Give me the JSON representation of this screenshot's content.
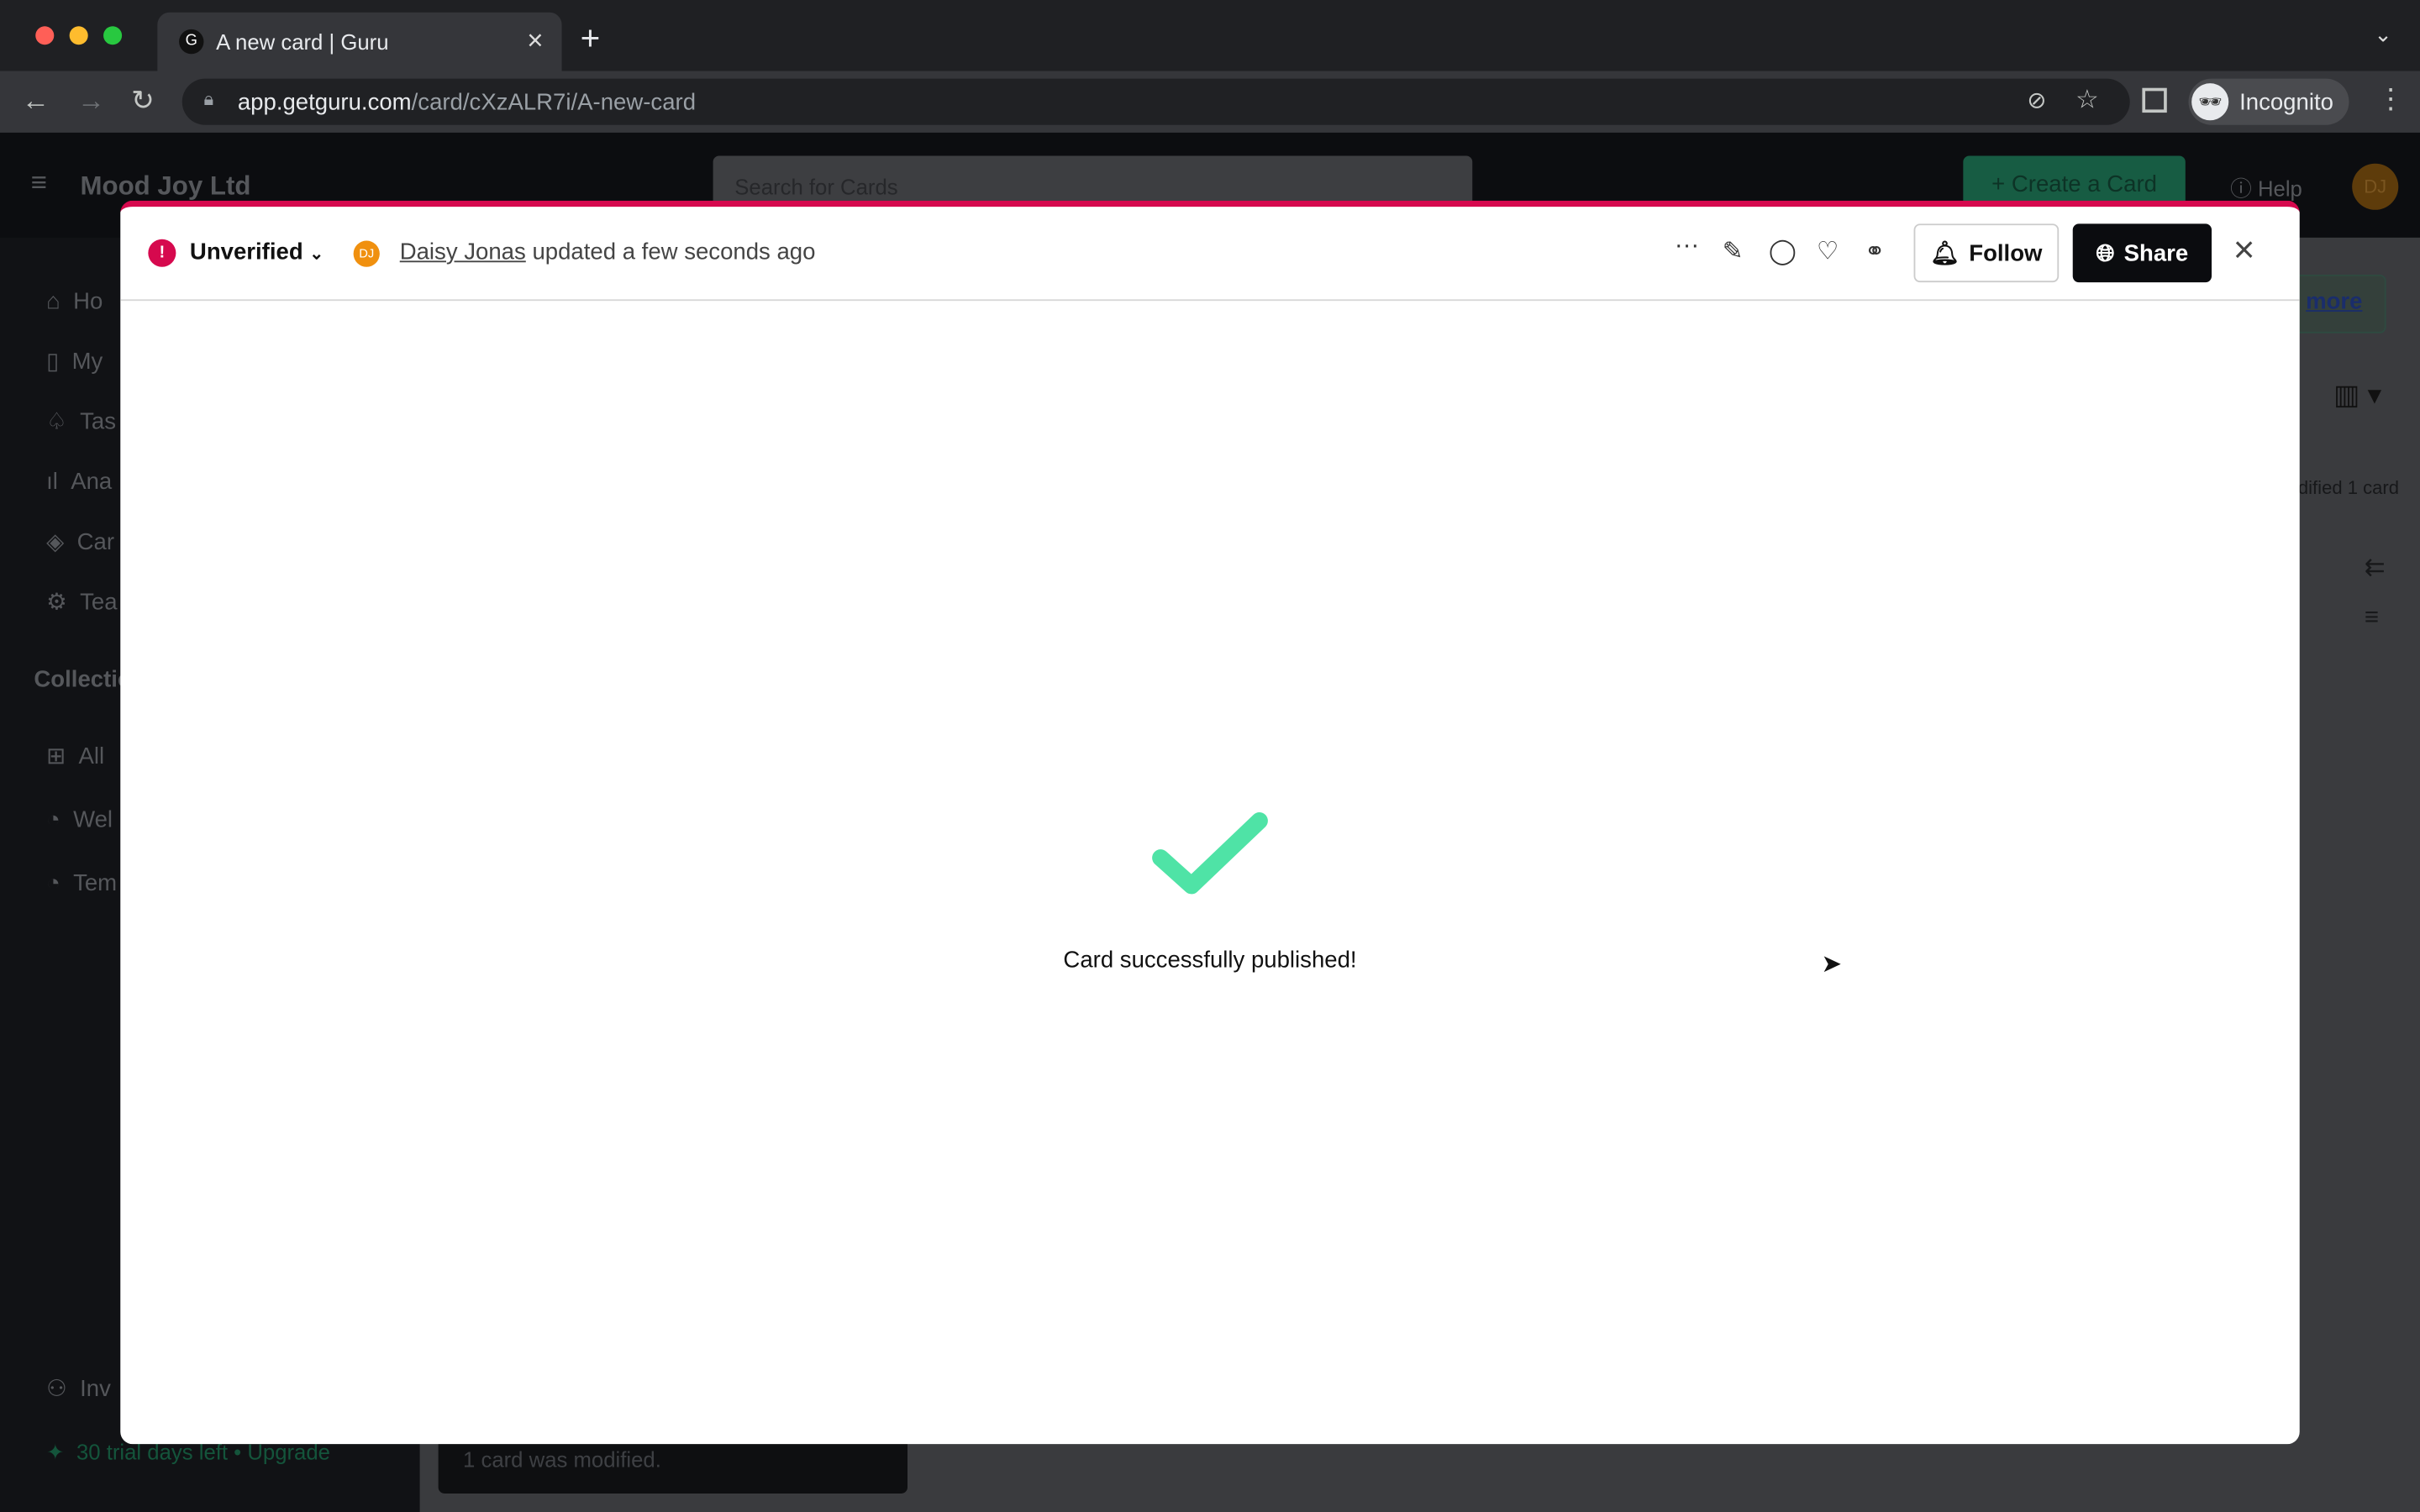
{
  "browser": {
    "tab_title": "A new card | Guru",
    "url_host": "app.getguru.com",
    "url_path": "/card/cXzALR7i/A-new-card",
    "profile": "Incognito"
  },
  "app": {
    "org_name": "Mood Joy Ltd",
    "search_placeholder": "Search for Cards",
    "create_label": "+ Create a Card",
    "help_label": "Help",
    "avatar": "DJ",
    "sidebar": [
      "Ho",
      "My",
      "Tas",
      "Ana",
      "Car",
      "Tea"
    ],
    "collections_label": "Collectio",
    "collections": [
      "All",
      "Wel",
      "Tem"
    ],
    "invite": "Inv",
    "trial": "30 trial days left • Upgrade",
    "toast": "1 card was modified.",
    "learn_more": "more",
    "modified": "dified 1 card"
  },
  "card": {
    "status": "Unverified",
    "author_initials": "DJ",
    "author": "Daisy Jonas",
    "updated": "updated a few seconds ago",
    "follow": "Follow",
    "share": "Share",
    "message": "Card successfully published!"
  },
  "colors": {
    "accent": "#d6094e",
    "success": "#4fe3a6",
    "avatar": "#f0900f"
  }
}
